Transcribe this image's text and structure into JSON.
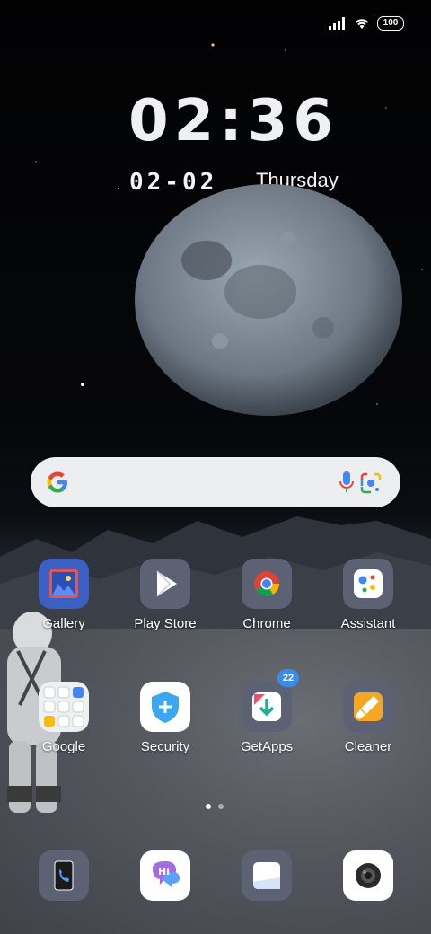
{
  "status_bar": {
    "battery": "100",
    "signal_icon": "signal-icon",
    "wifi_icon": "wifi-icon"
  },
  "clock": {
    "time": "02:36",
    "date": "02-02",
    "weekday": "Thursday"
  },
  "search": {
    "google_icon": "google-g-icon",
    "mic_icon": "mic-icon",
    "lens_icon": "lens-icon"
  },
  "apps_row1": [
    {
      "label": "Gallery",
      "icon": "gallery-icon"
    },
    {
      "label": "Play Store",
      "icon": "play-store-icon"
    },
    {
      "label": "Chrome",
      "icon": "chrome-icon"
    },
    {
      "label": "Assistant",
      "icon": "assistant-icon"
    }
  ],
  "apps_row2": [
    {
      "label": "Google",
      "icon": "google-folder-icon"
    },
    {
      "label": "Security",
      "icon": "security-icon"
    },
    {
      "label": "GetApps",
      "icon": "getapps-icon",
      "badge": "22"
    },
    {
      "label": "Cleaner",
      "icon": "cleaner-icon"
    }
  ],
  "page_indicator": {
    "pages": 2,
    "current": 1
  },
  "dock": [
    {
      "icon": "phone-icon"
    },
    {
      "icon": "messaging-icon"
    },
    {
      "icon": "notes-icon"
    },
    {
      "icon": "camera-icon"
    }
  ]
}
